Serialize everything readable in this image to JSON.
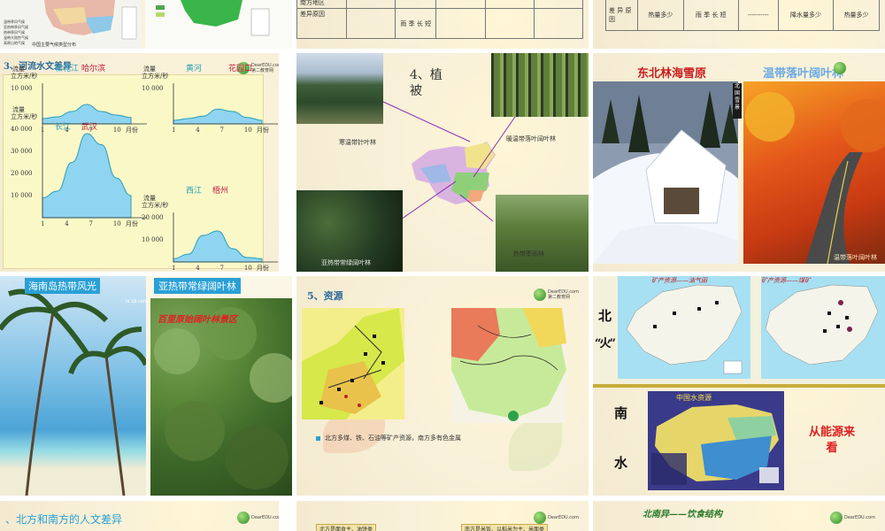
{
  "slide1": {
    "map_caption": "中国主要气候类型分布",
    "legend": [
      "温带季风气候",
      "亚热带季风气候",
      "热带季风气候",
      "温带大陆性气候",
      "高原山地气候"
    ]
  },
  "slide2": {
    "rows": [
      {
        "label": "南方地区",
        "value": ""
      },
      {
        "label": "差异原因",
        "value": "雨 季 长 短"
      }
    ]
  },
  "slide3": {
    "left_header": "差 异 原 因",
    "c1": "热量多少",
    "c2": "雨 季 长 短",
    "c3": "----------",
    "c4": "降水量多少",
    "c5": "热量多少"
  },
  "slide4": {
    "heading": "3、河流水文差异",
    "yunit_label": "流量",
    "yunit": "立方米/秒",
    "xunit": "月份",
    "charts": [
      {
        "river": "松花江",
        "city": "哈尔滨",
        "ymax": "10 000",
        "ymid": "",
        "x": [
          "1",
          "4",
          "7",
          "10"
        ],
        "values": [
          1500,
          2000,
          3500,
          5500,
          3500,
          2500,
          1800
        ]
      },
      {
        "river": "黄河",
        "city": "花园口",
        "ymax": "10 000",
        "ymid": "",
        "x": [
          "1",
          "4",
          "7",
          "10"
        ],
        "values": [
          1000,
          1500,
          2200,
          4200,
          3500,
          1800,
          1000
        ]
      },
      {
        "river": "长江",
        "city": "武汉",
        "ymax": "40 000",
        "ymid": "30 000",
        "ymid2": "20 000",
        "ymid3": "10 000",
        "x": [
          "1",
          "4",
          "7",
          "10"
        ],
        "values": [
          9000,
          12000,
          25000,
          38000,
          33000,
          18000,
          10000
        ]
      },
      {
        "river": "西江",
        "city": "梧州",
        "ymax": "20 000",
        "ymid": "10 000",
        "x": [
          "1",
          "4",
          "7",
          "10"
        ],
        "values": [
          1500,
          3500,
          12000,
          14000,
          6000,
          2000,
          1500
        ]
      }
    ]
  },
  "slide5": {
    "heading": "4、植被",
    "labels": {
      "tl": "寒温带针叶林",
      "tr": "暖温带落叶阔叶林",
      "bl": "亚热带常绿阔叶林",
      "br": "热带季雨林"
    }
  },
  "slide6": {
    "title_left": "东北林海雪原",
    "title_right": "温带落叶阔叶林",
    "photo_caption": "温带落叶阔叶林",
    "vertical_text": "北国雪景"
  },
  "slide7": {
    "label_left": "海南岛热带风光",
    "label_right": "亚热带常绿阔叶林",
    "photo_title": "百里原始阔叶林景区",
    "url": "hi.18.com"
  },
  "slide8": {
    "heading": "5、资源",
    "bullet": "北方多煤、铁、石油等矿产资源，南方多有色金属"
  },
  "slide9": {
    "top_left_title": "矿产资源——油气田",
    "top_right_title": "矿产资源——煤矿",
    "water_title": "中国水资源",
    "bei": "北",
    "huo": "“火”",
    "nan": "南",
    "shui": "水",
    "energy": "从能源来看"
  },
  "slide10": {
    "heading": "、北方和南方的人文差异"
  },
  "slide11": {
    "tag1": "北方是面食主、油饼类",
    "tag2": "南方是米饭、以稻米为主、米面类"
  },
  "slide12": {
    "heading": "北南异——饮食结构"
  },
  "logo": {
    "name": "DearEDU.com",
    "sub": "第二教育网"
  },
  "colors": {
    "accent_blue": "#2aa0d6",
    "title_red": "#d02a2a",
    "heading_green": "#2c7a2c"
  }
}
